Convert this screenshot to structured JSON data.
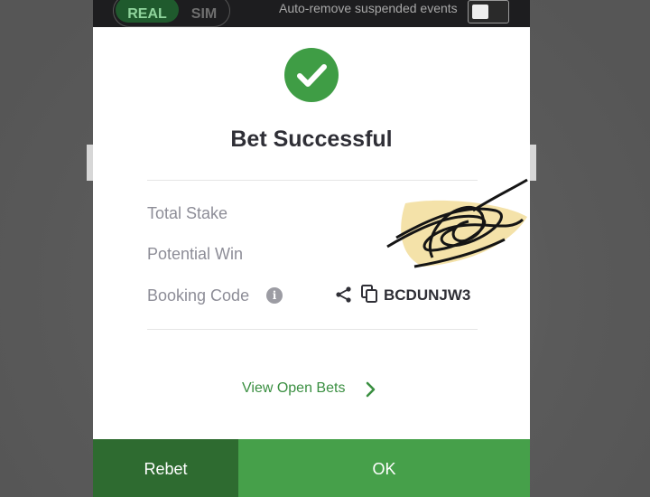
{
  "header": {
    "mode_real": "REAL",
    "mode_sim": "SIM",
    "auto_remove_label": "Auto-remove suspended events",
    "auto_remove_enabled": false
  },
  "modal": {
    "title": "Bet Successful",
    "icon": "check-circle-icon",
    "rows": {
      "total_stake": {
        "label": "Total Stake"
      },
      "potential_win": {
        "label": "Potential Win"
      },
      "booking_code": {
        "label": "Booking Code",
        "value": "BCDUNJW3"
      }
    },
    "view_open_bets": "View Open Bets"
  },
  "buttons": {
    "rebet": "Rebet",
    "ok": "OK"
  },
  "colors": {
    "accent_green": "#46a04a",
    "dark_green": "#2e6b30",
    "success_icon": "#3f9d45",
    "link_green": "#3a8f41",
    "top_bar": "#1d1d1f"
  }
}
